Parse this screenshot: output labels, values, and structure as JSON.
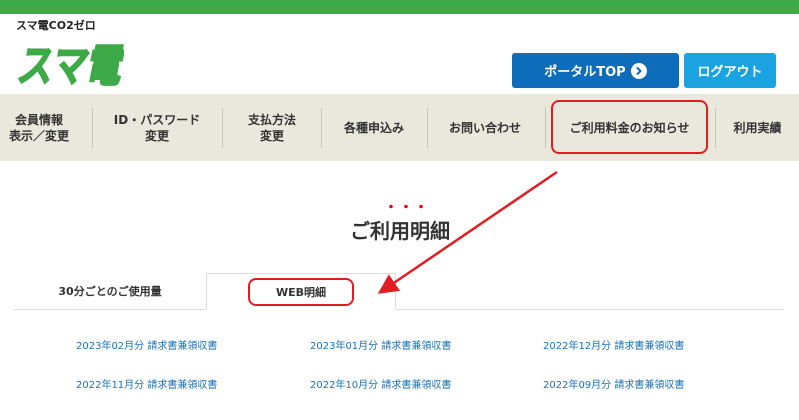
{
  "brand": {
    "tagline": "スマ電CO2ゼロ",
    "logo_text": "スマ電",
    "accent_color": "#3daa47"
  },
  "header": {
    "portal_button": {
      "label": "ポータルTOP",
      "icon": "chevron-right-circle-icon",
      "color": "#0d6dbb"
    },
    "logout_button": {
      "label": "ログアウト",
      "color": "#1aa3e0"
    }
  },
  "nav": {
    "items": [
      {
        "label": "会員情報\n表示／変更"
      },
      {
        "label": "ID・パスワード\n変更"
      },
      {
        "label": "支払方法\n変更"
      },
      {
        "label": "各種申込み"
      },
      {
        "label": "お問い合わせ"
      },
      {
        "label": "ご利用料金のお知らせ"
      },
      {
        "label": "利用実績"
      }
    ],
    "background": "#eae7dc"
  },
  "main": {
    "dots": "・・・",
    "title": "ご利用明細",
    "tabs": [
      {
        "label": "30分ごとのご使用量"
      },
      {
        "label": "WEB明細"
      }
    ],
    "statements": [
      "2023年02月分 請求書兼領収書",
      "2023年01月分 請求書兼領収書",
      "2022年12月分 請求書兼領収書",
      "2022年11月分 請求書兼領収書",
      "2022年10月分 請求書兼領収書",
      "2022年09月分 請求書兼領収書"
    ],
    "link_color": "#1a73b8"
  },
  "annotation": {
    "color": "#e01e22"
  }
}
